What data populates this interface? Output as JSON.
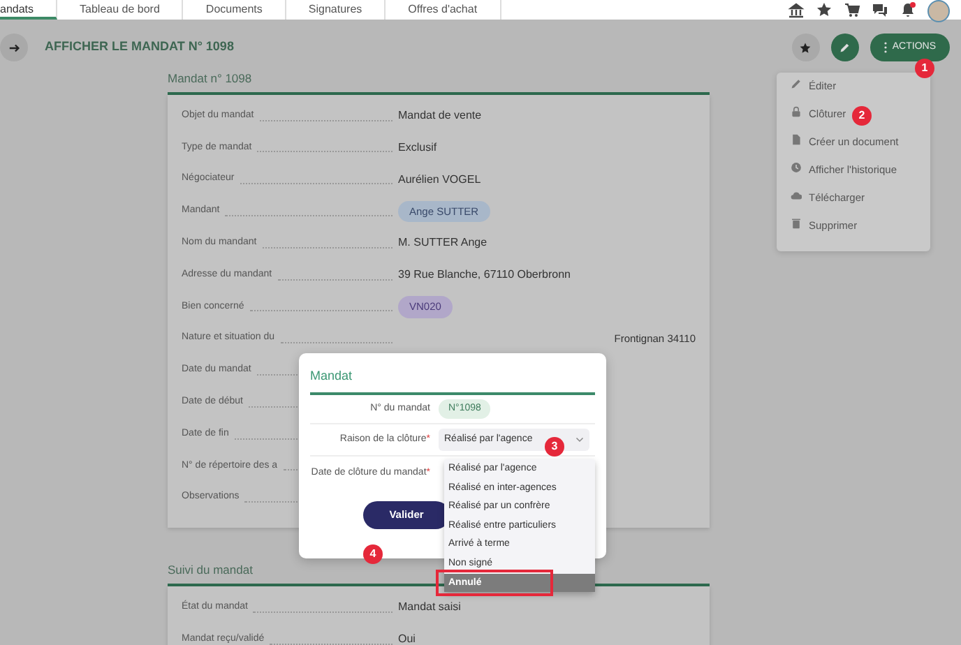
{
  "nav_tabs": [
    {
      "label": "andats",
      "selected": true
    },
    {
      "label": "Tableau de bord",
      "selected": false
    },
    {
      "label": "Documents",
      "selected": false
    },
    {
      "label": "Signatures",
      "selected": false
    },
    {
      "label": "Offres d'achat",
      "selected": false
    }
  ],
  "header": {
    "title": "AFFICHER LE MANDAT N° 1098",
    "actions_label": "ACTIONS"
  },
  "actions_menu": [
    {
      "label": "Éditer"
    },
    {
      "label": "Clôturer"
    },
    {
      "label": "Créer un document"
    },
    {
      "label": "Afficher l'historique"
    },
    {
      "label": "Télécharger"
    },
    {
      "label": "Supprimer"
    }
  ],
  "mandat_section": {
    "title": "Mandat n° 1098",
    "rows": [
      {
        "label": "Objet du mandat",
        "value": "Mandat de vente",
        "kind": "text"
      },
      {
        "label": "Type de mandat",
        "value": "Exclusif",
        "kind": "text"
      },
      {
        "label": "Négociateur",
        "value": "Aurélien VOGEL",
        "kind": "text"
      },
      {
        "label": "Mandant",
        "value": "Ange SUTTER",
        "kind": "tag",
        "color": "#a8b7c9"
      },
      {
        "label": "Nom du mandant",
        "value": "M. SUTTER Ange",
        "kind": "text"
      },
      {
        "label": "Adresse du mandant",
        "value": "39 Rue Blanche, 67110 Oberbronn",
        "kind": "text"
      },
      {
        "label": "Bien concerné",
        "value": "VN020",
        "kind": "tag",
        "color": "#b1a7c9"
      },
      {
        "label": "Nature et situation du",
        "value": "Frontignan 34110",
        "kind": "covered"
      },
      {
        "label": "Date du mandat",
        "kind": "covered"
      },
      {
        "label": "Date de début",
        "kind": "covered"
      },
      {
        "label": "Date de fin",
        "kind": "covered"
      },
      {
        "label": "N° de répertoire des a",
        "kind": "covered"
      },
      {
        "label": "Observations",
        "kind": "covered"
      }
    ]
  },
  "suivi_section": {
    "title": "Suivi du mandat",
    "rows": [
      {
        "label": "État du mandat",
        "value": "Mandat saisi",
        "kind": "text"
      },
      {
        "label": "Mandat reçu/validé",
        "value": "Oui",
        "kind": "text"
      }
    ]
  },
  "modal": {
    "title": "Mandat",
    "fields": [
      {
        "label": "N° du mandat",
        "kind": "badge",
        "value": "N°1098"
      },
      {
        "label": "Raison de la clôture",
        "required_mark": "*",
        "kind": "select",
        "value": "Réalisé par l'agence"
      },
      {
        "label": "Date de clôture du mandat",
        "required_mark": "*",
        "kind": "date"
      }
    ],
    "submit": "Valider",
    "options": [
      {
        "label": "Réalisé par l'agence",
        "selected": false,
        "highlighted": false
      },
      {
        "label": "Réalisé en inter-agences",
        "selected": false,
        "highlighted": false
      },
      {
        "label": "Réalisé par un confrère",
        "selected": false,
        "highlighted": false
      },
      {
        "label": "Réalisé entre particuliers",
        "selected": false,
        "highlighted": false
      },
      {
        "label": "Arrivé à terme",
        "selected": false,
        "highlighted": false
      },
      {
        "label": "Non signé",
        "selected": false,
        "highlighted": false
      },
      {
        "label": "Annulé",
        "selected": true,
        "highlighted": true
      }
    ]
  },
  "annotation_markers": [
    {
      "number": "1"
    },
    {
      "number": "2"
    },
    {
      "number": "3"
    },
    {
      "number": "4"
    }
  ]
}
